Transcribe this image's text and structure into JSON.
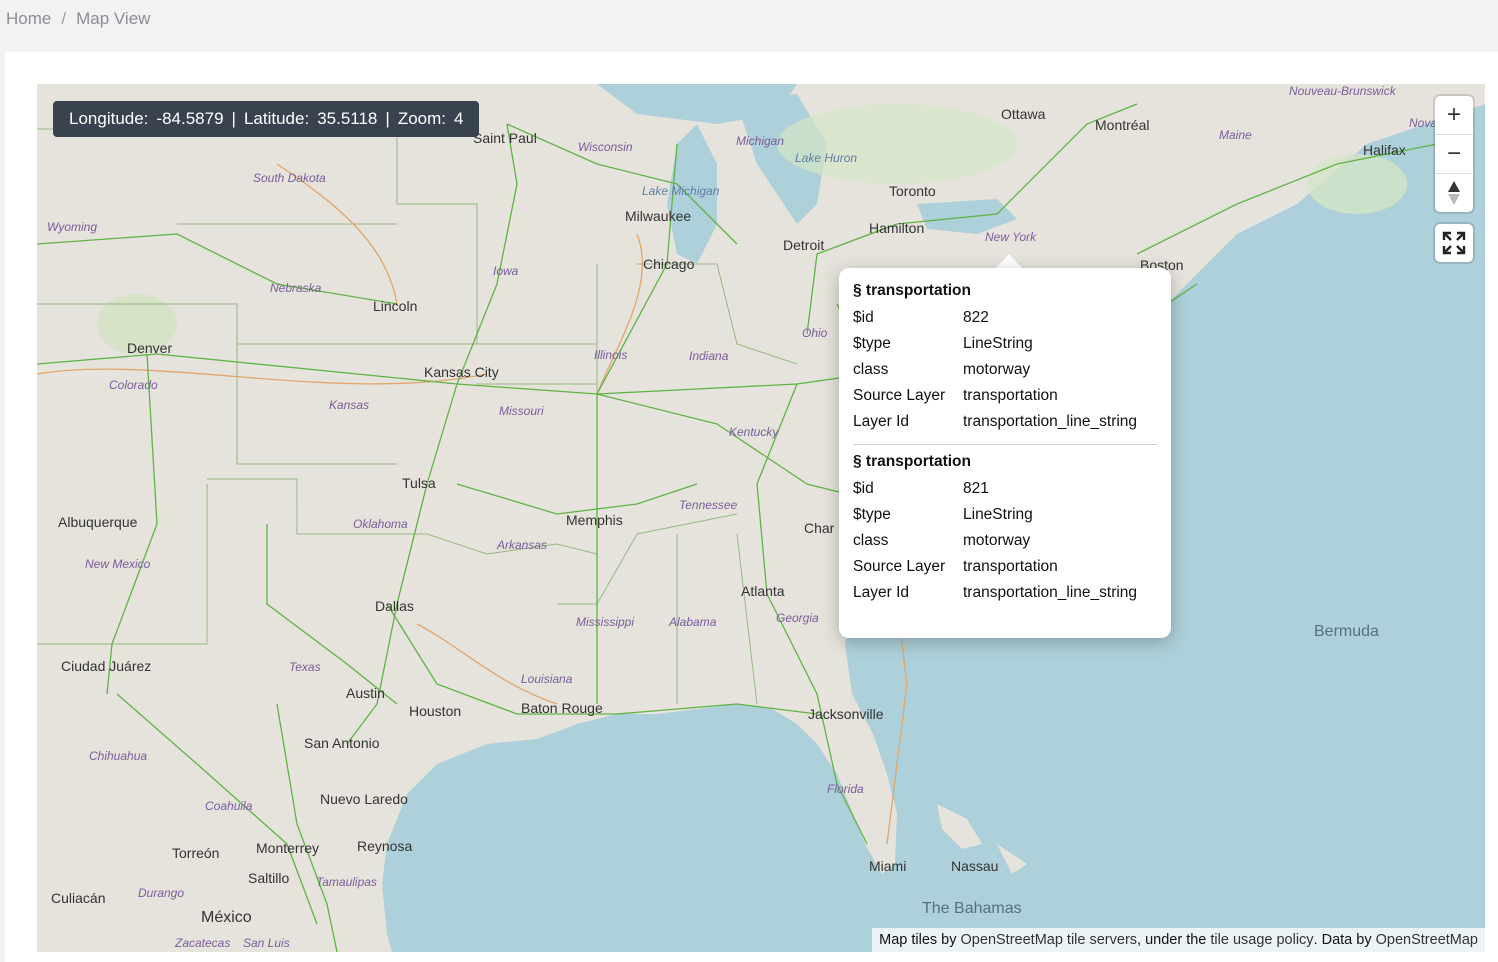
{
  "breadcrumb": {
    "home": "Home",
    "separator": "/",
    "current": "Map View"
  },
  "coords": {
    "lon_label": "Longitude:",
    "lon_value": "-84.5879",
    "lat_label": "Latitude:",
    "lat_value": "35.5118",
    "zoom_label": "Zoom:",
    "zoom_value": "4",
    "sep": "|"
  },
  "controls": {
    "zoom_in": "+",
    "zoom_out": "−",
    "compass": "▲"
  },
  "popup": {
    "features": [
      {
        "title": "§ transportation",
        "rows": [
          {
            "k": "$id",
            "v": "822"
          },
          {
            "k": "$type",
            "v": "LineString"
          },
          {
            "k": "class",
            "v": "motorway"
          },
          {
            "k": "Source Layer",
            "v": "transportation"
          },
          {
            "k": "Layer Id",
            "v": "transportation_line_string"
          }
        ]
      },
      {
        "title": "§ transportation",
        "rows": [
          {
            "k": "$id",
            "v": "821"
          },
          {
            "k": "$type",
            "v": "LineString"
          },
          {
            "k": "class",
            "v": "motorway"
          },
          {
            "k": "Source Layer",
            "v": "transportation"
          },
          {
            "k": "Layer Id",
            "v": "transportation_line_string"
          }
        ]
      }
    ]
  },
  "attribution": {
    "prefix": "Map tiles by ",
    "link1": "OpenStreetMap tile servers",
    "mid": ", under the ",
    "link2": "tile usage policy",
    "mid2": ". Data by ",
    "link3": "OpenStreetMap"
  },
  "labels": {
    "cities": [
      "Saint Paul",
      "Milwaukee",
      "Chicago",
      "Detroit",
      "Toronto",
      "Hamilton",
      "Ottawa",
      "Montréal",
      "Halifax",
      "Boston",
      "Lincoln",
      "Denver",
      "Kansas City",
      "Tulsa",
      "Memphis",
      "Albuquerque",
      "Dallas",
      "Atlanta",
      "Charlotte",
      "Austin",
      "San Antonio",
      "Houston",
      "Baton Rouge",
      "Jacksonville",
      "Miami",
      "Nassau",
      "Ciudad Juárez",
      "Nuevo Laredo",
      "Reynosa",
      "Torreón",
      "Monterrey",
      "Saltillo",
      "Culiacán",
      "México",
      "The Bahamas",
      "Bermuda"
    ],
    "states": [
      "South Dakota",
      "Wyoming",
      "Nebraska",
      "Colorado",
      "Kansas",
      "Iowa",
      "Illinois",
      "Indiana",
      "Ohio",
      "Missouri",
      "Kentucky",
      "Tennessee",
      "Oklahoma",
      "Arkansas",
      "Mississippi",
      "Alabama",
      "Georgia",
      "Louisiana",
      "Texas",
      "New Mexico",
      "Florida",
      "Wisconsin",
      "Michigan",
      "New York",
      "Maine",
      "Lake Michigan",
      "Lake Huron",
      "Nouveau-Brunswick",
      "Nova Scotia",
      "Chihuahua",
      "Coahuila",
      "Tamaulipas",
      "Durango",
      "Zacatecas",
      "San Luis"
    ]
  }
}
